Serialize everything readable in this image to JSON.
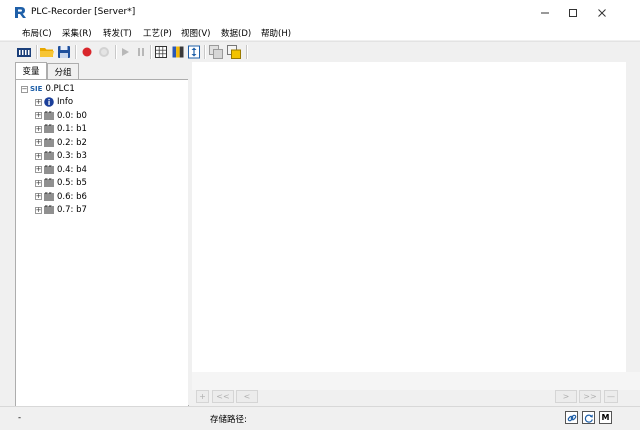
{
  "window": {
    "title": "PLC-Recorder  [Server*]"
  },
  "menu": [
    {
      "label": "布局(C)"
    },
    {
      "label": "采集(R)"
    },
    {
      "label": "转发(T)"
    },
    {
      "label": "工艺(P)"
    },
    {
      "label": "视图(V)"
    },
    {
      "label": "数据(D)"
    },
    {
      "label": "帮助(H)"
    }
  ],
  "toolbar": {
    "icons": [
      "plc-device-icon",
      "open-folder-icon",
      "save-icon",
      "record-icon",
      "stop-icon",
      "play-icon",
      "pause-icon",
      "grid-icon",
      "color-map-icon",
      "fit-height-icon",
      "copy-window-icon",
      "export-icon"
    ]
  },
  "left_panel": {
    "tabs": [
      {
        "label": "变量",
        "active": true
      },
      {
        "label": "分组",
        "active": false
      }
    ],
    "tree": {
      "root_prefix": "SIE",
      "root_label": "0.PLC1",
      "items": [
        {
          "label": "Info"
        },
        {
          "label": "0.0: b0"
        },
        {
          "label": "0.1: b1"
        },
        {
          "label": "0.2: b2"
        },
        {
          "label": "0.3: b3"
        },
        {
          "label": "0.4: b4"
        },
        {
          "label": "0.5: b5"
        },
        {
          "label": "0.6: b6"
        },
        {
          "label": "0.7: b7"
        }
      ]
    }
  },
  "nav": {
    "add": "+",
    "first": "<<",
    "prev": "<",
    "next": ">",
    "last": ">>",
    "minus": "—"
  },
  "status": {
    "left": "-",
    "storage_label": "存储路径:",
    "m_label": "M"
  },
  "colors": {
    "accent_blue": "#1e5fa8",
    "record_red": "#d9262b",
    "folder_yellow": "#f2b705"
  }
}
